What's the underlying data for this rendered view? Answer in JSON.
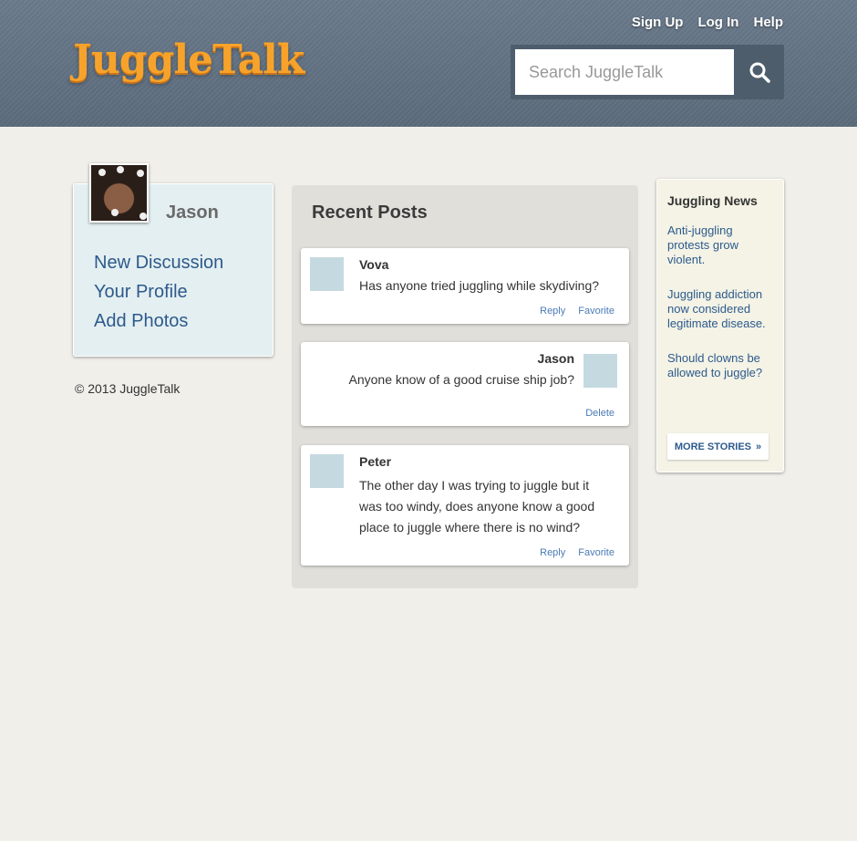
{
  "header": {
    "logo": "JuggleTalk",
    "nav": [
      "Sign Up",
      "Log In",
      "Help"
    ],
    "search_placeholder": "Search JuggleTalk",
    "search_icon": "search-icon"
  },
  "sidebar": {
    "user_name": "Jason",
    "links": [
      "New Discussion",
      "Your Profile",
      "Add Photos"
    ]
  },
  "footer": {
    "copyright": "© 2013 JuggleTalk"
  },
  "recent_posts": {
    "title": "Recent Posts",
    "posts": [
      {
        "author": "Vova",
        "text": "Has anyone tried juggling while skydiving?",
        "actions": [
          "Reply",
          "Favorite"
        ]
      },
      {
        "author": "Jason",
        "text": "Anyone know of a good cruise ship job?",
        "actions": [
          "Delete"
        ]
      },
      {
        "author": "Peter",
        "text": "The other day I was trying to juggle but it was too windy, does anyone know a good place to juggle where there is no wind?",
        "actions": [
          "Reply",
          "Favorite"
        ]
      }
    ]
  },
  "news": {
    "title": "Juggling News",
    "items": [
      "Anti-juggling protests grow violent.",
      "Juggling addiction now considered legitimate disease.",
      "Should clowns be allowed to juggle?"
    ],
    "more_label": "MORE STORIES",
    "more_arrow": "»"
  },
  "colors": {
    "header": "#667788",
    "logo": "#f7a32b",
    "link": "#2d5a8c",
    "page_bg": "#f0efea"
  }
}
